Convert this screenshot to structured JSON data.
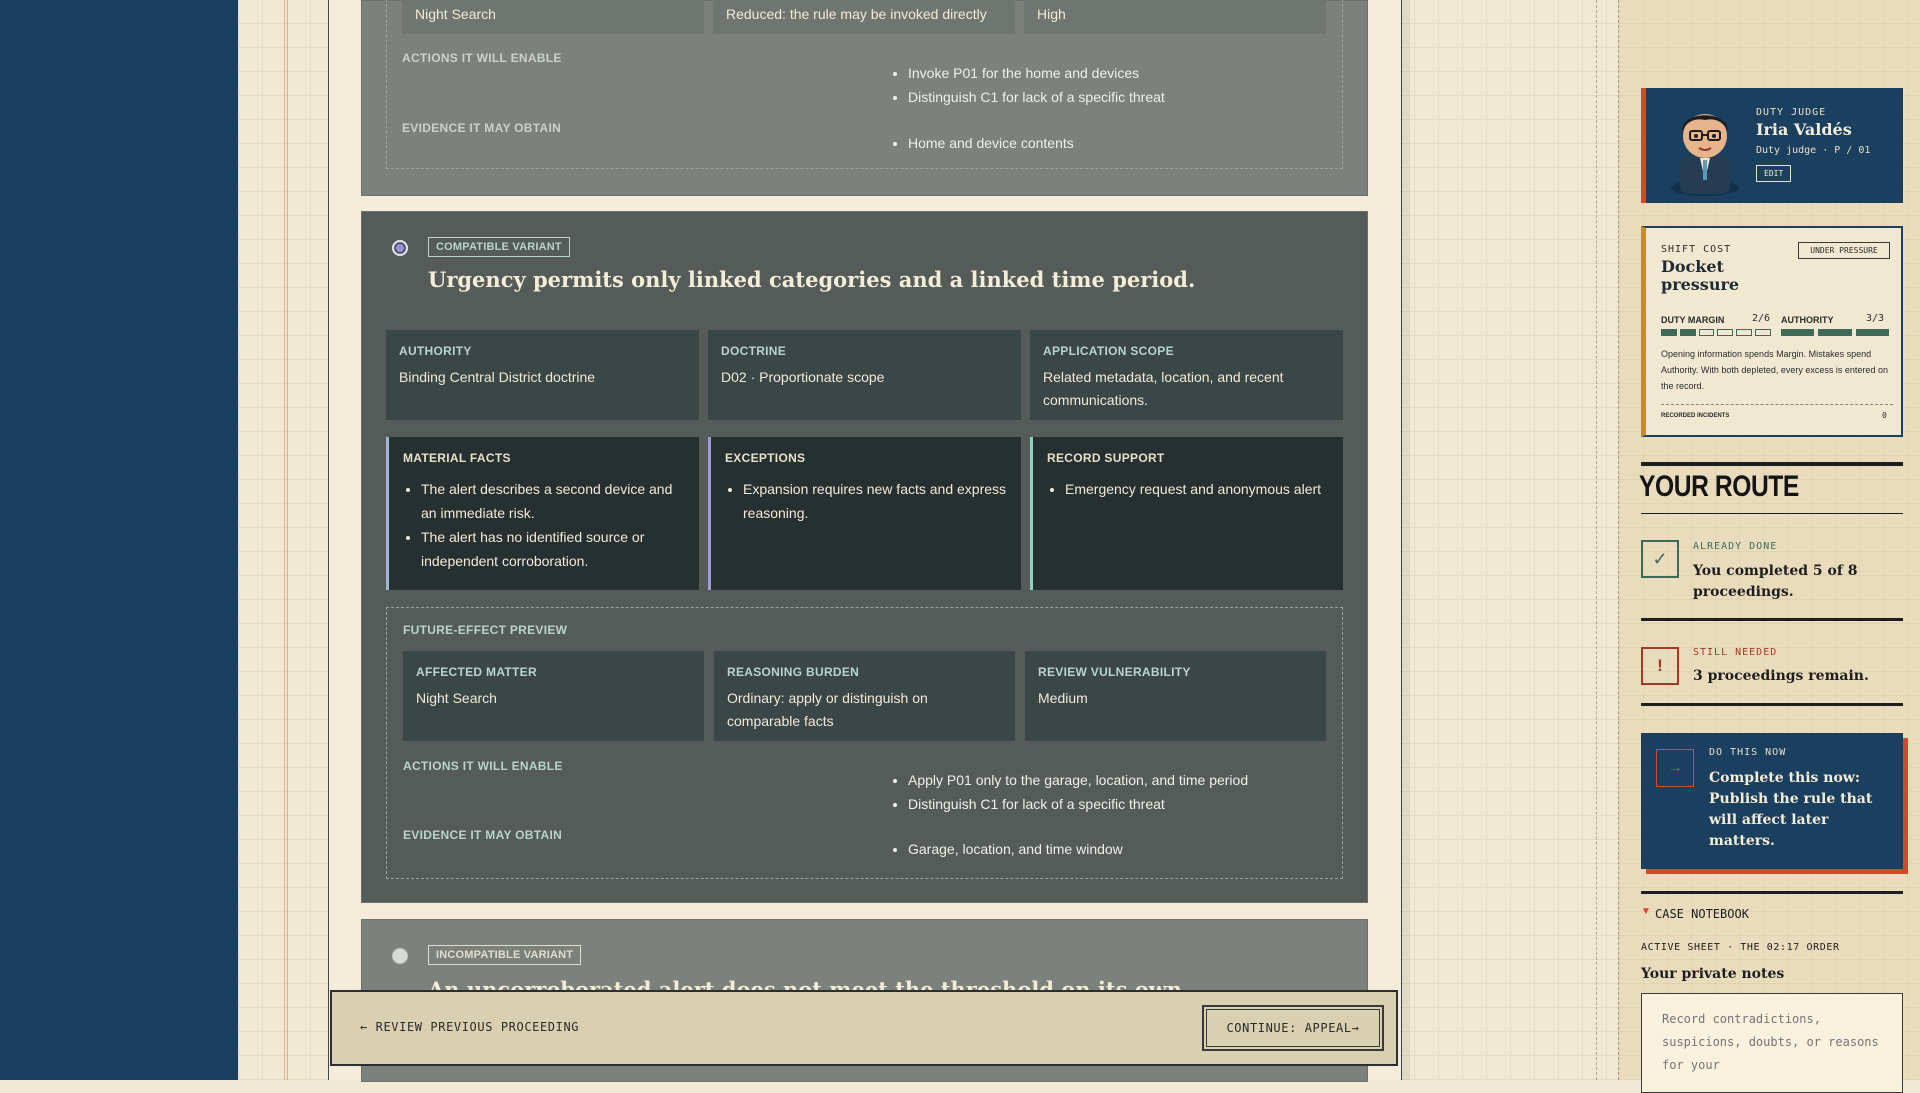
{
  "top_variant": {
    "tiles": [
      {
        "value": "Night Search"
      },
      {
        "value": "Reduced: the rule may be invoked directly"
      },
      {
        "value": "High"
      }
    ],
    "actions_label": "ACTIONS IT WILL ENABLE",
    "actions": [
      "Invoke P01 for the home and devices",
      "Distinguish C1 for lack of a specific threat"
    ],
    "evidence_label": "EVIDENCE IT MAY OBTAIN",
    "evidence": [
      "Home and device contents"
    ]
  },
  "mid_variant": {
    "badge": "COMPATIBLE VARIANT",
    "title": "Urgency permits only linked categories and a linked time period.",
    "info": [
      {
        "label": "AUTHORITY",
        "value": "Binding Central District doctrine"
      },
      {
        "label": "DOCTRINE",
        "value": "D02 · Proportionate scope"
      },
      {
        "label": "APPLICATION SCOPE",
        "value": "Related metadata, location, and recent communications."
      }
    ],
    "material_facts": {
      "label": "MATERIAL FACTS",
      "items": [
        "The alert describes a second device and an immediate risk.",
        "The alert has no identified source or independent corroboration."
      ]
    },
    "exceptions": {
      "label": "EXCEPTIONS",
      "items": [
        "Expansion requires new facts and express reasoning."
      ]
    },
    "record_support": {
      "label": "RECORD SUPPORT",
      "items": [
        "Emergency request and anonymous alert"
      ]
    },
    "preview": {
      "label": "FUTURE-EFFECT PREVIEW",
      "tiles": [
        {
          "label": "AFFECTED MATTER",
          "value": "Night Search"
        },
        {
          "label": "REASONING BURDEN",
          "value": "Ordinary: apply or distinguish on comparable facts"
        },
        {
          "label": "REVIEW VULNERABILITY",
          "value": "Medium"
        }
      ],
      "actions_label": "ACTIONS IT WILL ENABLE",
      "actions": [
        "Apply P01 only to the garage, location, and time period",
        "Distinguish C1 for lack of a specific threat"
      ],
      "evidence_label": "EVIDENCE IT MAY OBTAIN",
      "evidence": [
        "Garage, location, and time window"
      ]
    }
  },
  "bot_variant": {
    "badge": "INCOMPATIBLE VARIANT",
    "title": "An uncorroborated alert does not meet the threshold on its own."
  },
  "footer": {
    "prev": "← REVIEW PREVIOUS PROCEEDING",
    "next": "CONTINUE: APPEAL→"
  },
  "sidebar": {
    "judge": {
      "kicker": "DUTY JUDGE",
      "name": "Iria Valdés",
      "role": "Duty judge · P / 01",
      "edit": "EDIT"
    },
    "cost": {
      "kicker": "SHIFT COST",
      "title": "Docket pressure",
      "status": "UNDER PRESSURE",
      "margin_label": "DUTY MARGIN",
      "margin_value": "2/6",
      "margin_level": 2,
      "margin_max": 6,
      "authority_label": "AUTHORITY",
      "authority_value": "3/3",
      "authority_level": 3,
      "authority_max": 3,
      "note": "Opening information spends Margin. Mistakes spend Authority. With both depleted, every excess is entered on the record.",
      "incidents_label": "RECORDED INCIDENTS",
      "incidents_value": "0"
    },
    "route": {
      "title": "YOUR ROUTE",
      "done_kicker": "ALREADY DONE",
      "done_text": "You completed 5 of 8 proceedings.",
      "needed_kicker": "STILL NEEDED",
      "needed_text": "3 proceedings remain.",
      "now_kicker": "DO THIS NOW",
      "now_text": "Complete this now: Publish the rule that will affect later matters."
    },
    "notebook": {
      "toggle": "CASE NOTEBOOK",
      "sheet": "ACTIVE SHEET · THE 02:17 ORDER",
      "title": "Your private notes",
      "placeholder": "Record contradictions, suspicions, doubts, or reasons for your"
    }
  },
  "colors": {
    "navy": "#1b405f",
    "accent_red": "#d8472a",
    "mint": "#b9d4cb",
    "radio_selected": "#9b90e0"
  }
}
